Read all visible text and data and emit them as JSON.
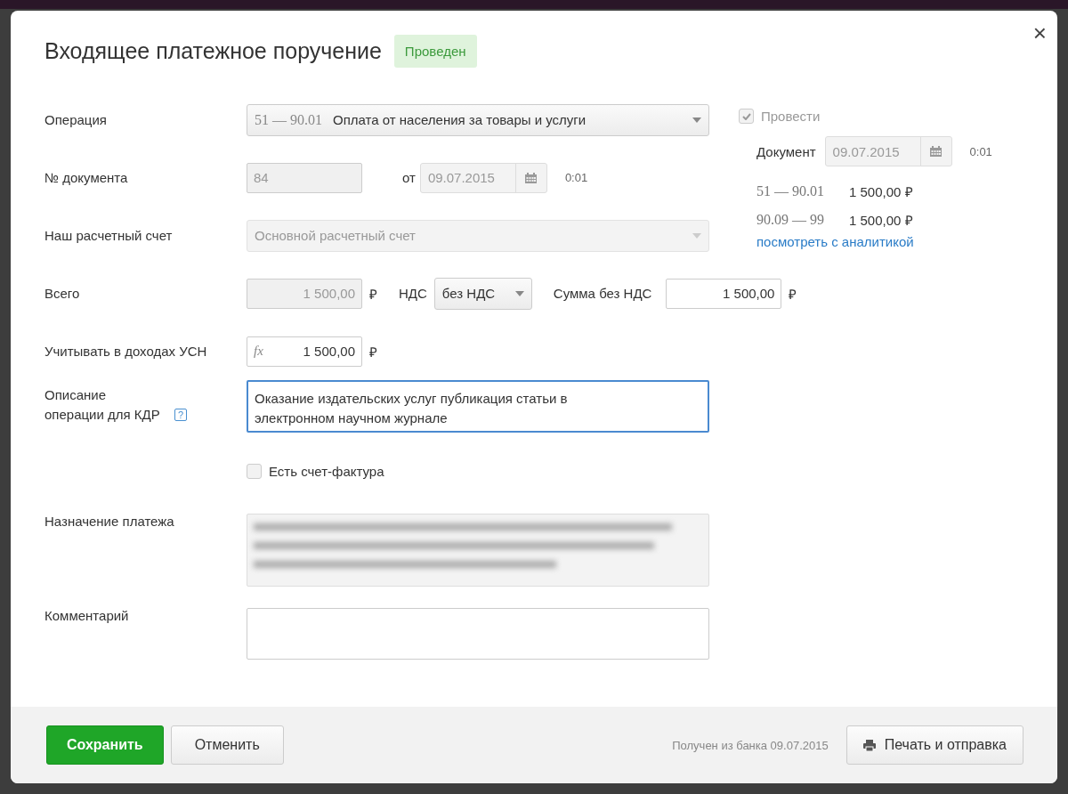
{
  "dialog": {
    "title": "Входящее платежное поручение",
    "status": "Проведен",
    "close": "×"
  },
  "operation": {
    "label": "Операция",
    "code": "51 — 90.01",
    "value": "Оплата от населения за товары и услуги",
    "disabled": false
  },
  "document": {
    "label": "№ документа",
    "number": "84",
    "number_disabled": true,
    "from_label": "от",
    "date": "09.07.2015",
    "date_disabled": true,
    "time": "0:01"
  },
  "account": {
    "label": "Наш расчетный счет",
    "value": "Основной расчетный счет",
    "disabled": true
  },
  "total": {
    "label": "Всего",
    "value": "1 500,00",
    "currency": "₽",
    "disabled": true,
    "vat_label": "НДС",
    "vat_value": "без НДС",
    "net_label": "Сумма без НДС",
    "net_value": "1 500,00",
    "net_currency": "₽"
  },
  "usn": {
    "label": "Учитывать в доходах УСН",
    "formula": "fx",
    "value": "1 500,00",
    "currency": "₽"
  },
  "description": {
    "label": "Описание операции для КДР",
    "help": "?",
    "value": "Оказание издательских услуг публикация статьи в электронном научном журнале",
    "focused": true
  },
  "invoice": {
    "label": "Есть счет-фактура",
    "checked": false
  },
  "purpose": {
    "label": "Назначение платежа",
    "disabled": true
  },
  "comment": {
    "label": "Комментарий"
  },
  "posting": {
    "label": "Провести",
    "checked": true,
    "doc_label": "Документ",
    "date": "09.07.2015",
    "time": "0:01",
    "entries": [
      {
        "accounts": "51 — 90.01",
        "amount": "1 500,00 ₽"
      },
      {
        "accounts": "90.09 — 99",
        "amount": "1 500,00 ₽"
      }
    ],
    "link": "посмотреть с аналитикой"
  },
  "footer": {
    "save": "Сохранить",
    "cancel": "Отменить",
    "received": "Получен из банка 09.07.2015",
    "print": "Печать и отправка"
  }
}
